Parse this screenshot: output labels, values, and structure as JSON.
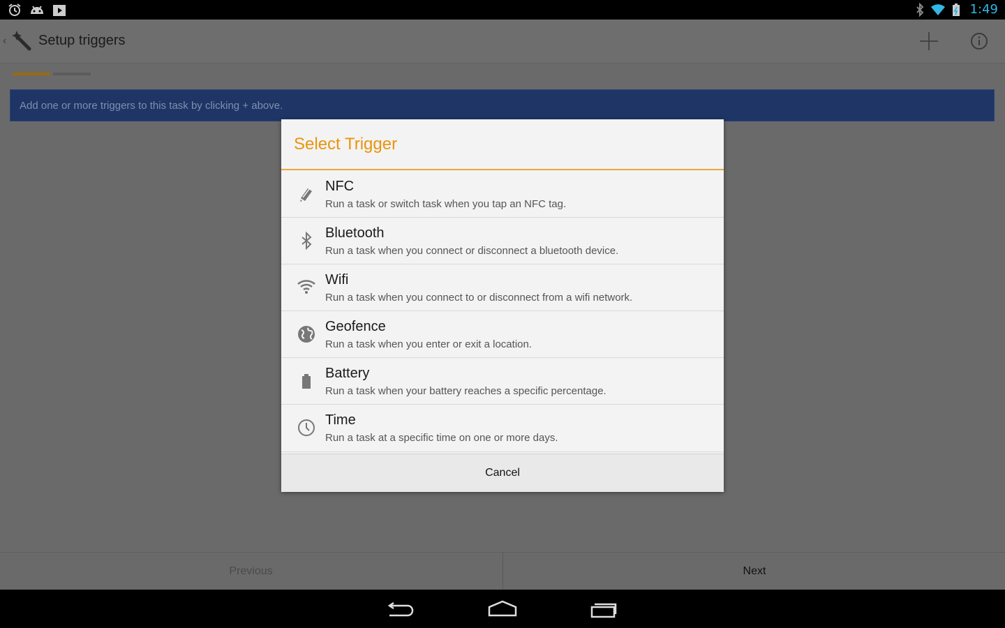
{
  "statusbar": {
    "time": "1:49"
  },
  "appbar": {
    "title": "Setup triggers"
  },
  "banner": {
    "text": "Add one or more triggers to this task by clicking + above."
  },
  "dialog": {
    "title": "Select Trigger",
    "items": [
      {
        "title": "NFC",
        "desc": "Run a task or switch task when you tap an NFC tag.",
        "icon": "nfc-icon"
      },
      {
        "title": "Bluetooth",
        "desc": "Run a task when you connect or disconnect a bluetooth device.",
        "icon": "bluetooth-icon"
      },
      {
        "title": "Wifi",
        "desc": "Run a task when you connect to or disconnect from a wifi network.",
        "icon": "wifi-icon"
      },
      {
        "title": "Geofence",
        "desc": "Run a task when you enter or exit a location.",
        "icon": "globe-icon"
      },
      {
        "title": "Battery",
        "desc": "Run a task when your battery reaches a specific percentage.",
        "icon": "battery-icon"
      },
      {
        "title": "Time",
        "desc": "Run a task at a specific time on one or more days.",
        "icon": "clock-icon"
      }
    ],
    "cancel": "Cancel"
  },
  "bottom": {
    "previous": "Previous",
    "next": "Next"
  },
  "colors": {
    "accent": "#e8950e",
    "banner": "#1e3565",
    "clock": "#33b5e5"
  }
}
